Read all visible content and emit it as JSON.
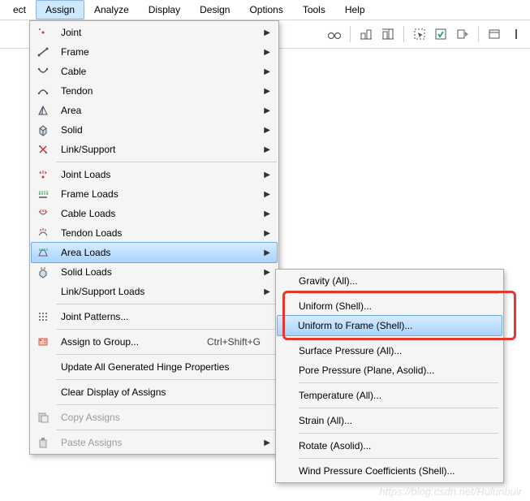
{
  "menubar": {
    "items": [
      "ect",
      "Assign",
      "Analyze",
      "Display",
      "Design",
      "Options",
      "Tools",
      "Help"
    ],
    "open_index": 1
  },
  "dropdown": {
    "items": [
      {
        "label": "Joint",
        "sub": true
      },
      {
        "label": "Frame",
        "sub": true
      },
      {
        "label": "Cable",
        "sub": true
      },
      {
        "label": "Tendon",
        "sub": true
      },
      {
        "label": "Area",
        "sub": true
      },
      {
        "label": "Solid",
        "sub": true
      },
      {
        "label": "Link/Support",
        "sub": true
      },
      {
        "sep": true
      },
      {
        "label": "Joint Loads",
        "sub": true
      },
      {
        "label": "Frame Loads",
        "sub": true
      },
      {
        "label": "Cable Loads",
        "sub": true
      },
      {
        "label": "Tendon Loads",
        "sub": true
      },
      {
        "label": "Area Loads",
        "sub": true,
        "highlight": true
      },
      {
        "label": "Solid Loads",
        "sub": true
      },
      {
        "label": "Link/Support Loads",
        "sub": true
      },
      {
        "sep": true
      },
      {
        "label": "Joint Patterns..."
      },
      {
        "sep": true
      },
      {
        "label": "Assign to Group...",
        "shortcut": "Ctrl+Shift+G"
      },
      {
        "sep": true
      },
      {
        "label": "Update All Generated Hinge Properties"
      },
      {
        "sep": true
      },
      {
        "label": "Clear Display of Assigns"
      },
      {
        "sep": true
      },
      {
        "label": "Copy Assigns",
        "disabled": true
      },
      {
        "sep": true
      },
      {
        "label": "Paste Assigns",
        "sub": true,
        "disabled": true
      }
    ]
  },
  "submenu": {
    "items": [
      {
        "label": "Gravity (All)..."
      },
      {
        "sep": true
      },
      {
        "label": "Uniform (Shell)..."
      },
      {
        "label": "Uniform to Frame (Shell)...",
        "highlight": true
      },
      {
        "sep": true
      },
      {
        "label": "Surface Pressure (All)..."
      },
      {
        "label": "Pore Pressure (Plane, Asolid)..."
      },
      {
        "sep": true
      },
      {
        "label": "Temperature (All)..."
      },
      {
        "sep": true
      },
      {
        "label": "Strain (All)..."
      },
      {
        "sep": true
      },
      {
        "label": "Rotate (Asolid)..."
      },
      {
        "sep": true
      },
      {
        "label": "Wind Pressure Coefficients (Shell)..."
      }
    ]
  },
  "watermark": "https://blog.csdn.net/Hulunbuir"
}
